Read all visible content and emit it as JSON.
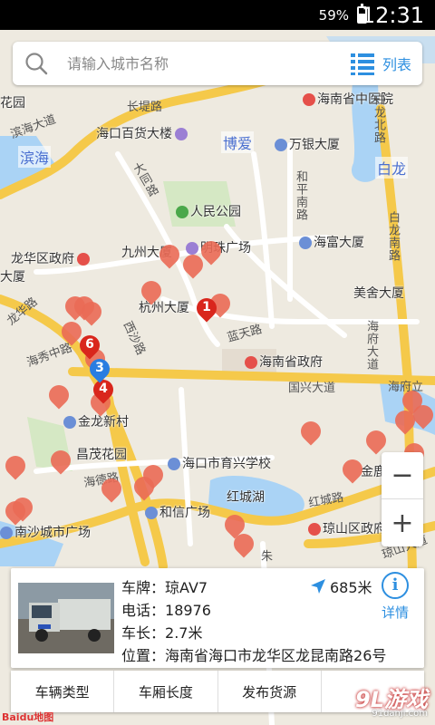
{
  "status_bar": {
    "battery_percent": "59%",
    "battery_level": 0.59,
    "time": "12:31"
  },
  "search": {
    "placeholder": "请输入城市名称",
    "list_label": "列表"
  },
  "map": {
    "provider_logo": "Baidu地图",
    "districts": [
      "滨海",
      "博爱",
      "白龙"
    ],
    "pois": [
      {
        "name": "海南省中医院",
        "icon": "hospital-icon"
      },
      {
        "name": "海口百货大楼",
        "icon": "shopping-icon"
      },
      {
        "name": "万银大厦",
        "icon": "building-icon"
      },
      {
        "name": "人民公园",
        "icon": "park-icon"
      },
      {
        "name": "九州大厦",
        "icon": "building-icon"
      },
      {
        "name": "明珠广场",
        "icon": "shopping-icon"
      },
      {
        "name": "海富大厦",
        "icon": "building-icon"
      },
      {
        "name": "龙华区政府",
        "icon": "government-icon"
      },
      {
        "name": "杭州大厦",
        "icon": "building-icon"
      },
      {
        "name": "美舍大厦",
        "icon": "building-icon"
      },
      {
        "name": "海南省政府",
        "icon": "government-icon"
      },
      {
        "name": "金龙新村",
        "icon": "building-icon"
      },
      {
        "name": "昌茂花园",
        "icon": "building-icon"
      },
      {
        "name": "海口市育兴学校",
        "icon": "school-icon"
      },
      {
        "name": "红城湖",
        "icon": "lake-icon"
      },
      {
        "name": "和信广场",
        "icon": "building-icon"
      },
      {
        "name": "南沙城市广场",
        "icon": "building-icon"
      },
      {
        "name": "金鹿大厦",
        "icon": "building-icon"
      },
      {
        "name": "琼山区政府",
        "icon": "government-icon"
      },
      {
        "name": "大厦",
        "icon": "building-icon"
      },
      {
        "name": "花园",
        "icon": "building-icon"
      }
    ],
    "roads": [
      "滨海大道",
      "长堤路",
      "大同路",
      "和平南路",
      "白龙南路",
      "龙华路",
      "海秀中路",
      "西沙路",
      "蓝天路",
      "海府大道",
      "国兴大道",
      "海德路",
      "红城路",
      "白龙北路",
      "海府立",
      "琼山大道",
      "朱"
    ],
    "cluster_pins": [
      "1",
      "6",
      "3",
      "4"
    ]
  },
  "zoom": {
    "in": "+",
    "out": "−"
  },
  "vehicle": {
    "plate_label": "车牌：",
    "plate_value": "琼AV7",
    "phone_label": "电话：",
    "phone_value": "18976",
    "length_label": "车长：",
    "length_value": "2.7米",
    "location_label": "位置：",
    "location_value": "海南省海口市龙华区龙昆南路26号",
    "distance": "685米",
    "detail_label": "详情"
  },
  "tabs": [
    "车辆类型",
    "车厢长度",
    "发布货源"
  ],
  "watermark": {
    "brand": "9L游戏",
    "url": "91danji.com"
  }
}
